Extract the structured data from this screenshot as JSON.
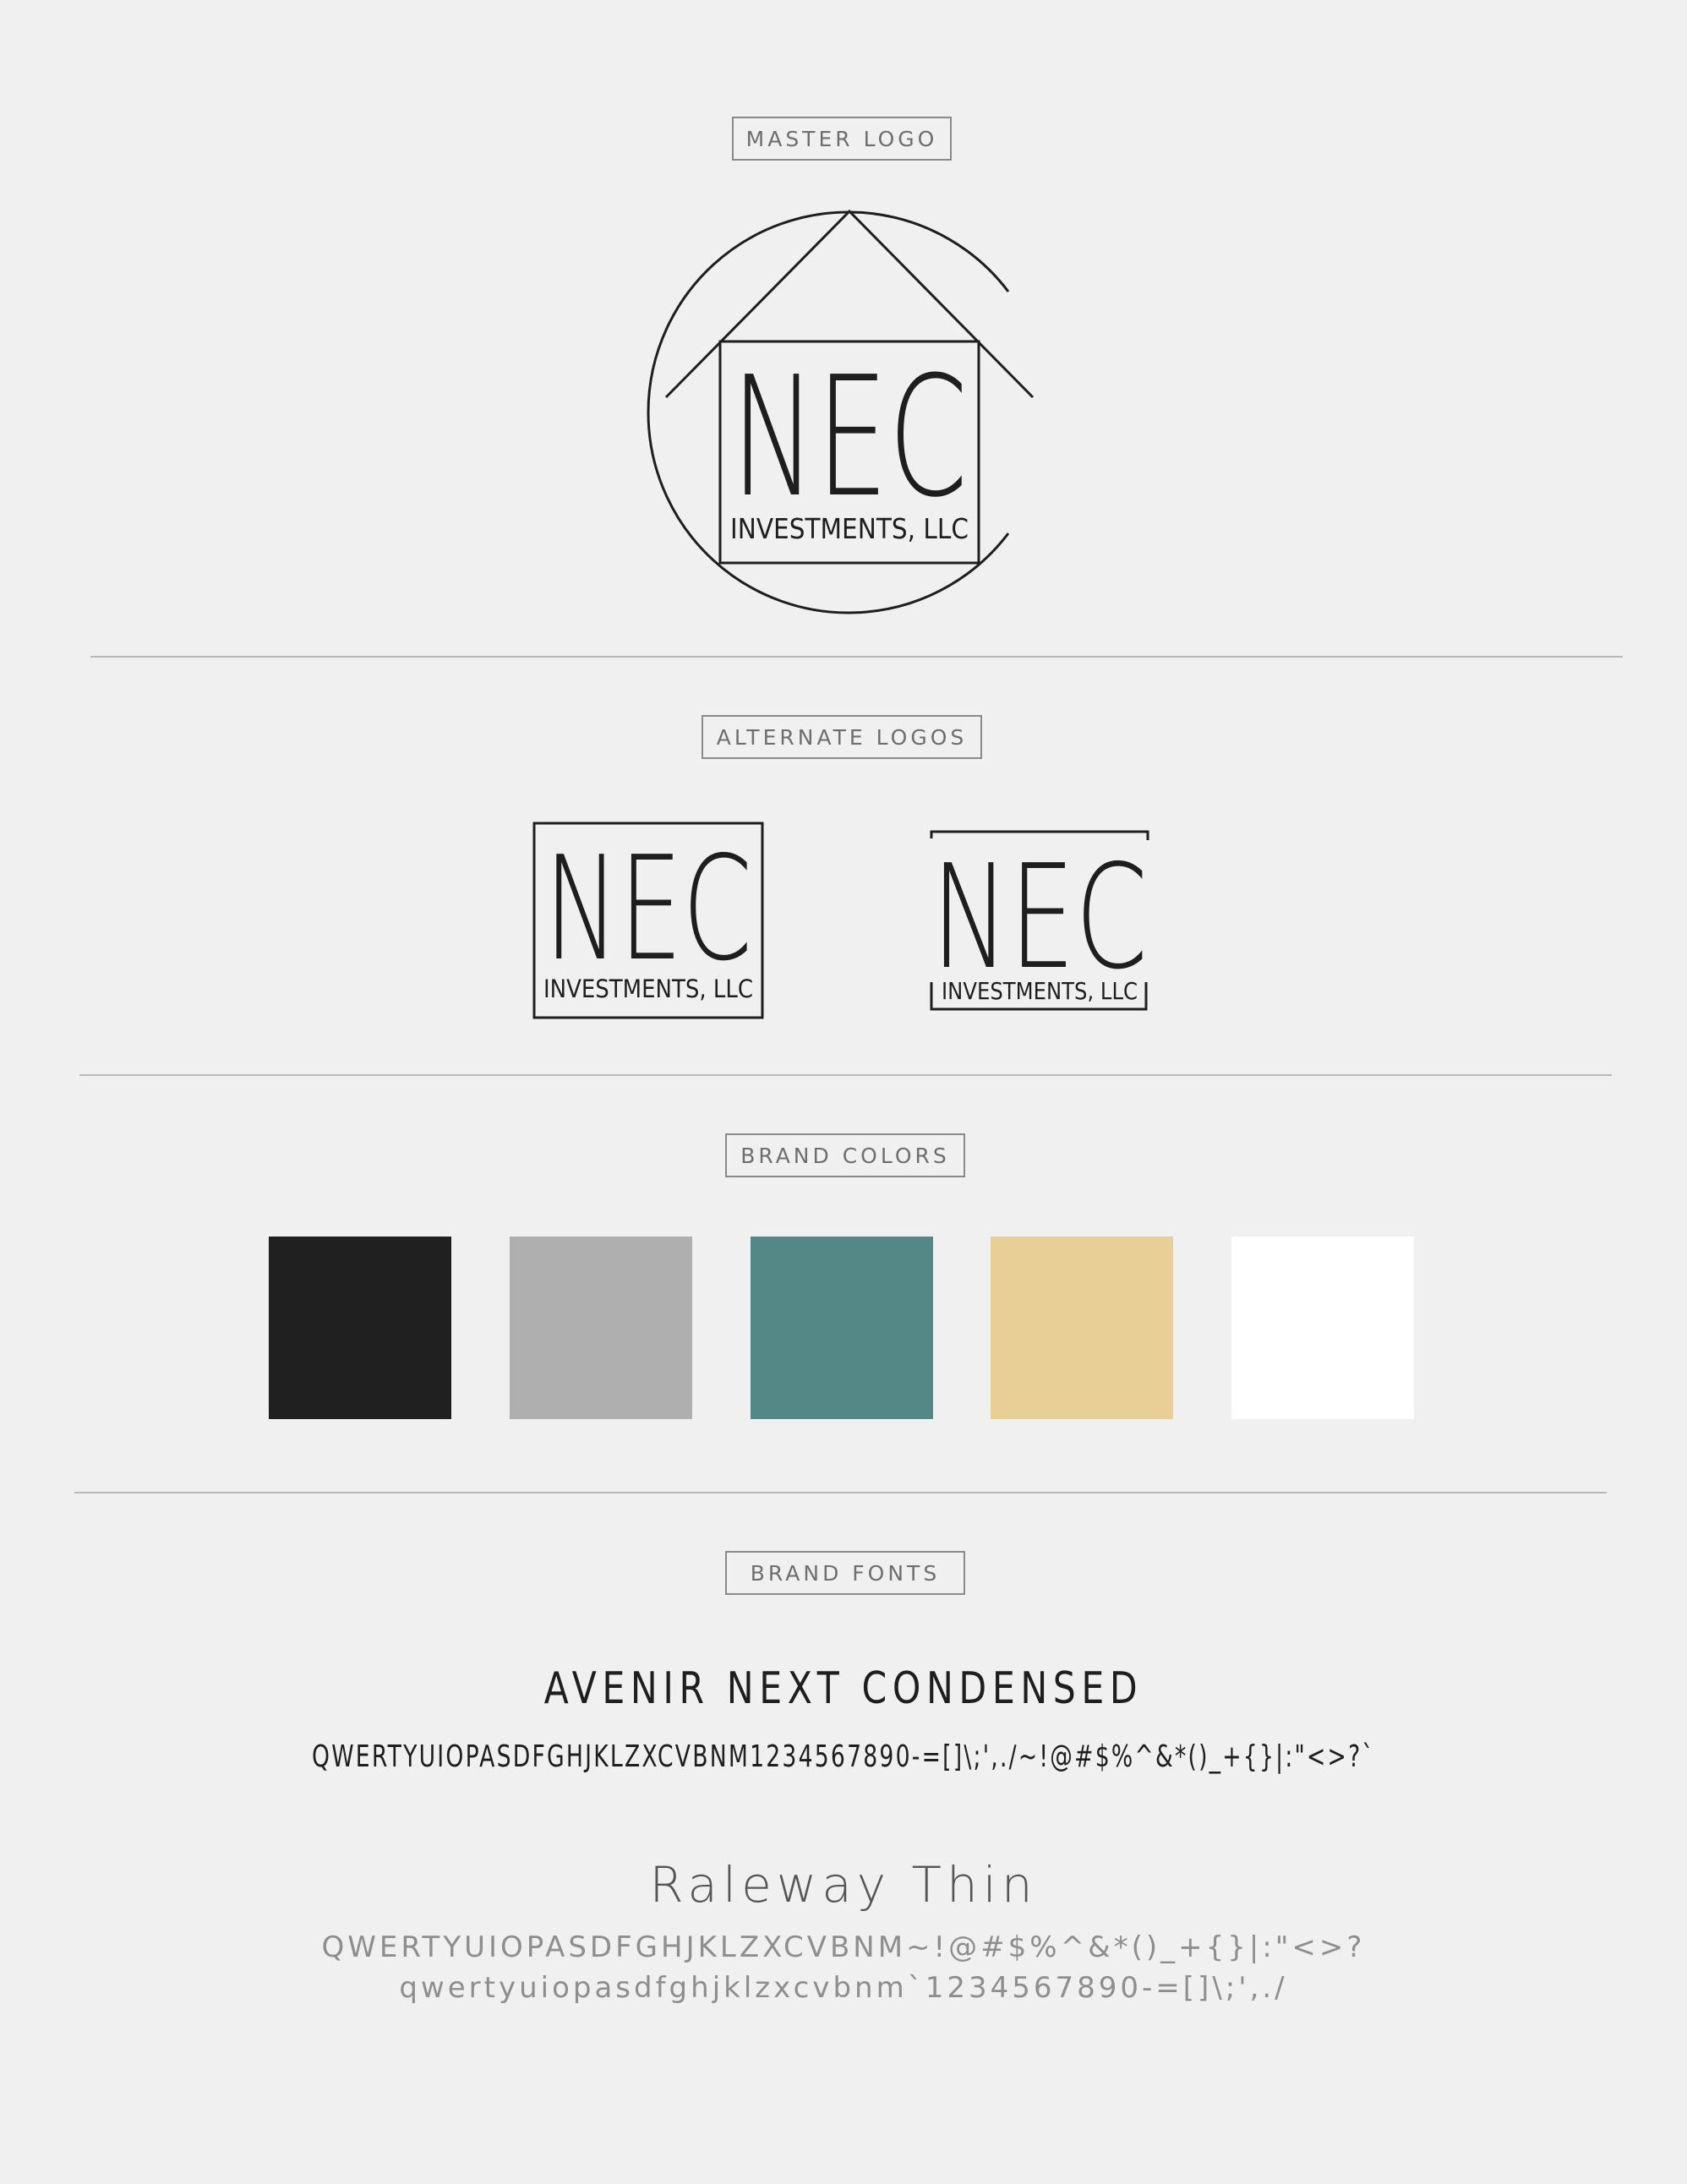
{
  "sections": {
    "master_logo": "MASTER LOGO",
    "alternate_logos": "ALTERNATE LOGOS",
    "brand_colors": "BRAND COLORS",
    "brand_fonts": "BRAND FONTS"
  },
  "logo": {
    "mark": "NEC",
    "subtitle": "INVESTMENTS, LLC"
  },
  "colors": [
    "#212021",
    "#b0afaf",
    "#538887",
    "#e8cf96",
    "#ffffff"
  ],
  "fonts": {
    "primary": {
      "name": "AVENIR NEXT CONDENSED",
      "sample": "QWERTYUIOPASDFGHJKLZXCVBNM1234567890-=[]\\;',./~!@#$%^&*()_+{}|:\"<>?`"
    },
    "secondary": {
      "name": "Raleway Thin",
      "sample_upper": "QWERTYUIOPASDFGHJKLZXCVBNM~!@#$%^&*()_+{}|:\"<>?",
      "sample_lower": "qwertyuiopasdfghjklzxcvbnm`1234567890-=[]\\;',./"
    }
  }
}
